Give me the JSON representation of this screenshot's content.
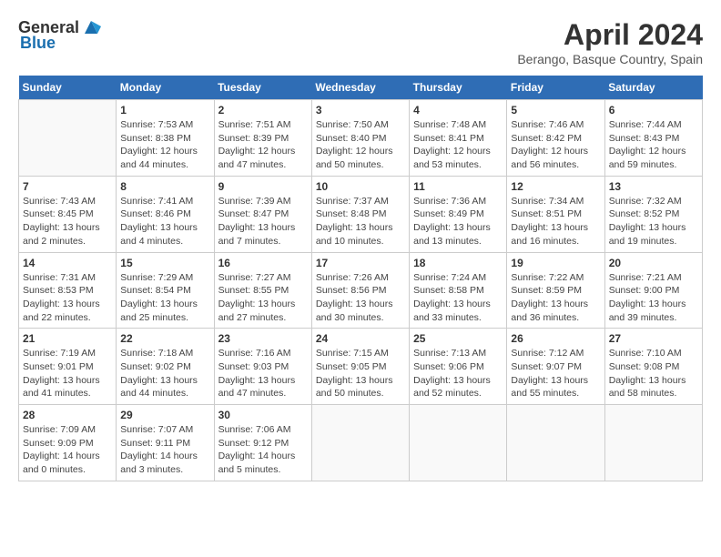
{
  "header": {
    "logo_general": "General",
    "logo_blue": "Blue",
    "month_year": "April 2024",
    "location": "Berango, Basque Country, Spain"
  },
  "calendar": {
    "days_of_week": [
      "Sunday",
      "Monday",
      "Tuesday",
      "Wednesday",
      "Thursday",
      "Friday",
      "Saturday"
    ],
    "weeks": [
      [
        {
          "day": "",
          "info": ""
        },
        {
          "day": "1",
          "info": "Sunrise: 7:53 AM\nSunset: 8:38 PM\nDaylight: 12 hours\nand 44 minutes."
        },
        {
          "day": "2",
          "info": "Sunrise: 7:51 AM\nSunset: 8:39 PM\nDaylight: 12 hours\nand 47 minutes."
        },
        {
          "day": "3",
          "info": "Sunrise: 7:50 AM\nSunset: 8:40 PM\nDaylight: 12 hours\nand 50 minutes."
        },
        {
          "day": "4",
          "info": "Sunrise: 7:48 AM\nSunset: 8:41 PM\nDaylight: 12 hours\nand 53 minutes."
        },
        {
          "day": "5",
          "info": "Sunrise: 7:46 AM\nSunset: 8:42 PM\nDaylight: 12 hours\nand 56 minutes."
        },
        {
          "day": "6",
          "info": "Sunrise: 7:44 AM\nSunset: 8:43 PM\nDaylight: 12 hours\nand 59 minutes."
        }
      ],
      [
        {
          "day": "7",
          "info": "Sunrise: 7:43 AM\nSunset: 8:45 PM\nDaylight: 13 hours\nand 2 minutes."
        },
        {
          "day": "8",
          "info": "Sunrise: 7:41 AM\nSunset: 8:46 PM\nDaylight: 13 hours\nand 4 minutes."
        },
        {
          "day": "9",
          "info": "Sunrise: 7:39 AM\nSunset: 8:47 PM\nDaylight: 13 hours\nand 7 minutes."
        },
        {
          "day": "10",
          "info": "Sunrise: 7:37 AM\nSunset: 8:48 PM\nDaylight: 13 hours\nand 10 minutes."
        },
        {
          "day": "11",
          "info": "Sunrise: 7:36 AM\nSunset: 8:49 PM\nDaylight: 13 hours\nand 13 minutes."
        },
        {
          "day": "12",
          "info": "Sunrise: 7:34 AM\nSunset: 8:51 PM\nDaylight: 13 hours\nand 16 minutes."
        },
        {
          "day": "13",
          "info": "Sunrise: 7:32 AM\nSunset: 8:52 PM\nDaylight: 13 hours\nand 19 minutes."
        }
      ],
      [
        {
          "day": "14",
          "info": "Sunrise: 7:31 AM\nSunset: 8:53 PM\nDaylight: 13 hours\nand 22 minutes."
        },
        {
          "day": "15",
          "info": "Sunrise: 7:29 AM\nSunset: 8:54 PM\nDaylight: 13 hours\nand 25 minutes."
        },
        {
          "day": "16",
          "info": "Sunrise: 7:27 AM\nSunset: 8:55 PM\nDaylight: 13 hours\nand 27 minutes."
        },
        {
          "day": "17",
          "info": "Sunrise: 7:26 AM\nSunset: 8:56 PM\nDaylight: 13 hours\nand 30 minutes."
        },
        {
          "day": "18",
          "info": "Sunrise: 7:24 AM\nSunset: 8:58 PM\nDaylight: 13 hours\nand 33 minutes."
        },
        {
          "day": "19",
          "info": "Sunrise: 7:22 AM\nSunset: 8:59 PM\nDaylight: 13 hours\nand 36 minutes."
        },
        {
          "day": "20",
          "info": "Sunrise: 7:21 AM\nSunset: 9:00 PM\nDaylight: 13 hours\nand 39 minutes."
        }
      ],
      [
        {
          "day": "21",
          "info": "Sunrise: 7:19 AM\nSunset: 9:01 PM\nDaylight: 13 hours\nand 41 minutes."
        },
        {
          "day": "22",
          "info": "Sunrise: 7:18 AM\nSunset: 9:02 PM\nDaylight: 13 hours\nand 44 minutes."
        },
        {
          "day": "23",
          "info": "Sunrise: 7:16 AM\nSunset: 9:03 PM\nDaylight: 13 hours\nand 47 minutes."
        },
        {
          "day": "24",
          "info": "Sunrise: 7:15 AM\nSunset: 9:05 PM\nDaylight: 13 hours\nand 50 minutes."
        },
        {
          "day": "25",
          "info": "Sunrise: 7:13 AM\nSunset: 9:06 PM\nDaylight: 13 hours\nand 52 minutes."
        },
        {
          "day": "26",
          "info": "Sunrise: 7:12 AM\nSunset: 9:07 PM\nDaylight: 13 hours\nand 55 minutes."
        },
        {
          "day": "27",
          "info": "Sunrise: 7:10 AM\nSunset: 9:08 PM\nDaylight: 13 hours\nand 58 minutes."
        }
      ],
      [
        {
          "day": "28",
          "info": "Sunrise: 7:09 AM\nSunset: 9:09 PM\nDaylight: 14 hours\nand 0 minutes."
        },
        {
          "day": "29",
          "info": "Sunrise: 7:07 AM\nSunset: 9:11 PM\nDaylight: 14 hours\nand 3 minutes."
        },
        {
          "day": "30",
          "info": "Sunrise: 7:06 AM\nSunset: 9:12 PM\nDaylight: 14 hours\nand 5 minutes."
        },
        {
          "day": "",
          "info": ""
        },
        {
          "day": "",
          "info": ""
        },
        {
          "day": "",
          "info": ""
        },
        {
          "day": "",
          "info": ""
        }
      ]
    ]
  }
}
